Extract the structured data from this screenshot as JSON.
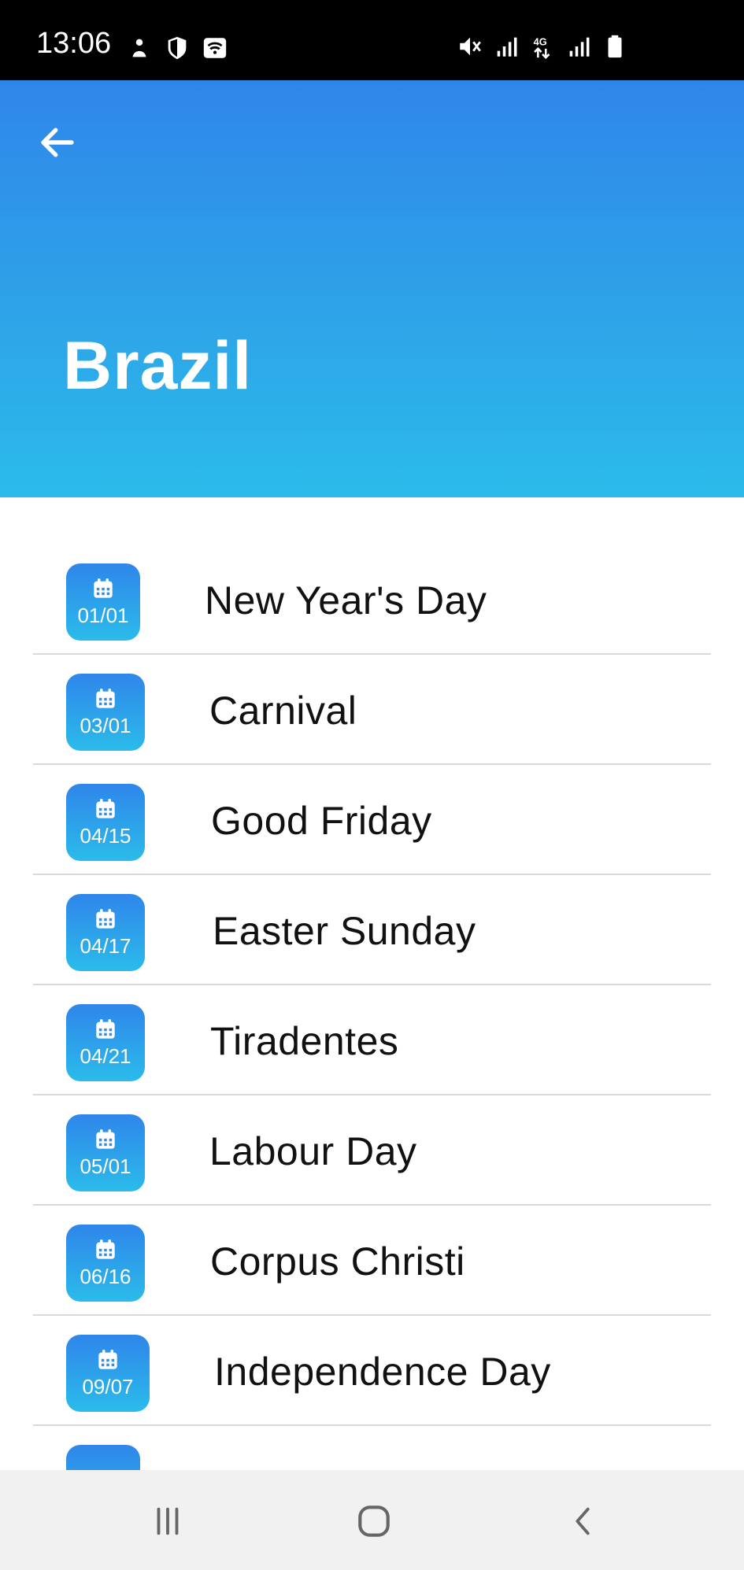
{
  "status_bar": {
    "time": "13:06",
    "left_icons": [
      "notification-icon",
      "shield-icon",
      "wifi-calling-icon"
    ],
    "right_icons": [
      "mute-icon",
      "signal-icon",
      "4g-data-icon",
      "signal-icon",
      "battery-icon"
    ]
  },
  "header": {
    "back_icon": "arrow-left-icon",
    "title": "Brazil"
  },
  "holidays": [
    {
      "date": "01/01",
      "name": "New Year's Day"
    },
    {
      "date": "03/01",
      "name": "Carnival"
    },
    {
      "date": "04/15",
      "name": "Good Friday"
    },
    {
      "date": "04/17",
      "name": "Easter Sunday"
    },
    {
      "date": "04/21",
      "name": "Tiradentes"
    },
    {
      "date": "05/01",
      "name": "Labour Day"
    },
    {
      "date": "06/16",
      "name": "Corpus Christi"
    },
    {
      "date": "09/07",
      "name": "Independence Day"
    }
  ],
  "nav_bar": {
    "icons": [
      "recent-apps-icon",
      "home-icon",
      "back-icon"
    ]
  },
  "colors": {
    "header_top": "#2f86ea",
    "header_bottom": "#2bbbea",
    "text": "#111111",
    "divider": "#d9d9d9"
  }
}
